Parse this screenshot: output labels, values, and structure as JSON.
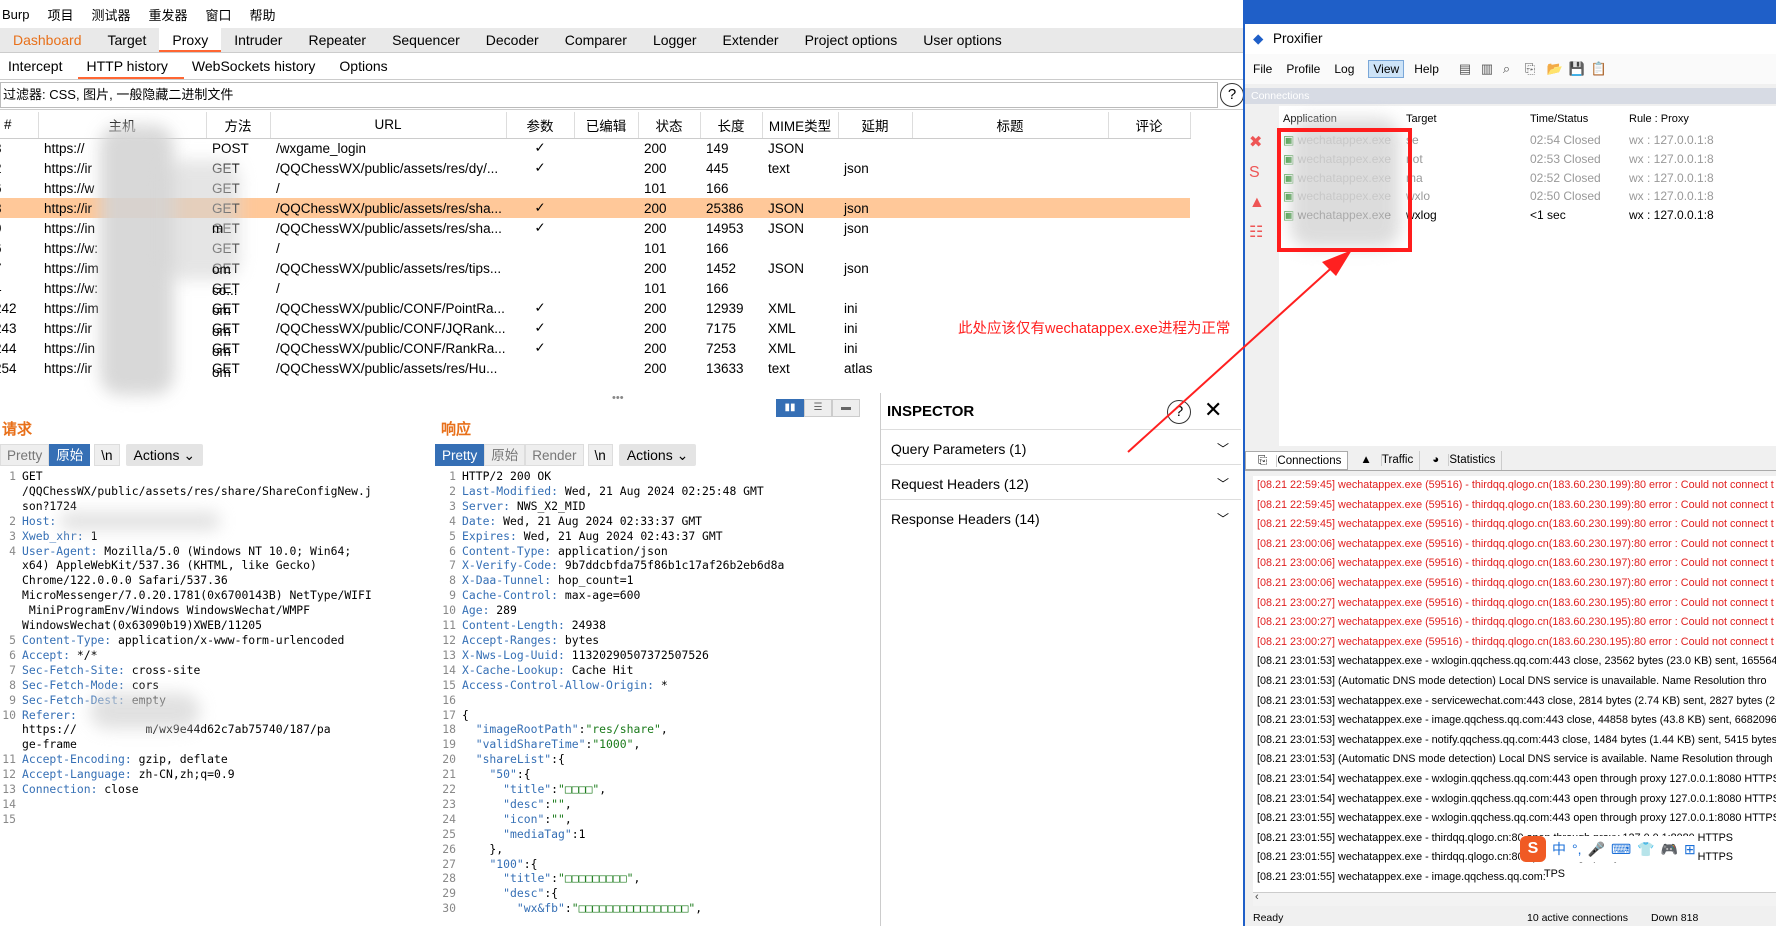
{
  "burp": {
    "menu": [
      "Burp",
      "项目",
      "测试器",
      "重发器",
      "窗口",
      "帮助"
    ],
    "tabs": [
      "Dashboard",
      "Target",
      "Proxy",
      "Intruder",
      "Repeater",
      "Sequencer",
      "Decoder",
      "Comparer",
      "Logger",
      "Extender",
      "Project options",
      "User options"
    ],
    "active_tab": "Proxy",
    "subtabs": [
      "Intercept",
      "HTTP history",
      "WebSockets history",
      "Options"
    ],
    "filter_text": "过滤器: CSS, 图片, 一般隐藏二进制文件",
    "help": "?",
    "columns": [
      "#",
      "主机",
      "方法",
      "URL",
      "参数",
      "已编辑",
      "状态",
      "长度",
      "MIME类型",
      "延期",
      "标题",
      "评论"
    ],
    "rows": [
      {
        "id": "3",
        "host": "https://",
        "method": "POST",
        "url": "/wxgame_login",
        "params": "✓",
        "status": "200",
        "length": "149",
        "mime": "JSON",
        "ext": ""
      },
      {
        "id": "2",
        "host": "https://ir",
        "method": "GET",
        "url": "/QQChessWX/public/assets/res/dy/...",
        "params": "✓",
        "status": "200",
        "length": "445",
        "mime": "text",
        "ext": "json"
      },
      {
        "id": "6",
        "host": "https://w",
        "method": "GET",
        "url": "/",
        "params": "",
        "status": "101",
        "length": "166",
        "mime": "",
        "ext": ""
      },
      {
        "id": "8",
        "host": "https://ir",
        "method": "GET",
        "url": "/QQChessWX/public/assets/res/sha...",
        "params": "✓",
        "status": "200",
        "length": "25386",
        "mime": "JSON",
        "ext": "json"
      },
      {
        "id": "9",
        "host": "https://in",
        "method": "GET",
        "url": "/QQChessWX/public/assets/res/sha...",
        "params": "✓",
        "status": "200",
        "length": "14953",
        "mime": "JSON",
        "ext": "json"
      },
      {
        "id": "6",
        "host": "https://w:",
        "method": "GET",
        "url": "/",
        "params": "",
        "status": "101",
        "length": "166",
        "mime": "",
        "ext": ""
      },
      {
        "id": "7",
        "host": "https://im",
        "method": "GET",
        "url": "/QQChessWX/public/assets/res/tips...",
        "params": "",
        "status": "200",
        "length": "1452",
        "mime": "JSON",
        "ext": "json"
      },
      {
        "id": "4",
        "host": "https://w:",
        "method": "GET",
        "url": "/",
        "params": "",
        "status": "101",
        "length": "166",
        "mime": "",
        "ext": ""
      },
      {
        "id": "242",
        "host": "https://im",
        "method": "GET",
        "url": "/QQChessWX/public/CONF/PointRa...",
        "params": "✓",
        "status": "200",
        "length": "12939",
        "mime": "XML",
        "ext": "ini"
      },
      {
        "id": "243",
        "host": "https://ir",
        "method": "GET",
        "url": "/QQChessWX/public/CONF/JQRank...",
        "params": "✓",
        "status": "200",
        "length": "7175",
        "mime": "XML",
        "ext": "ini"
      },
      {
        "id": "244",
        "host": "https://in",
        "method": "GET",
        "url": "/QQChessWX/public/CONF/RankRa...",
        "params": "✓",
        "status": "200",
        "length": "7253",
        "mime": "XML",
        "ext": "ini"
      },
      {
        "id": "254",
        "host": "https://ir",
        "method": "GET",
        "url": "/QQChessWX/public/assets/res/Hu...",
        "params": "",
        "status": "200",
        "length": "13633",
        "mime": "text",
        "ext": "atlas"
      }
    ],
    "host_suffixes": [
      "",
      "",
      "",
      "",
      "m",
      "",
      "om",
      "co...",
      "om",
      "om",
      "om",
      "om"
    ],
    "selected_row": 3,
    "request": {
      "title": "请求",
      "buttons": [
        "Pretty",
        "原始",
        "\\n"
      ],
      "active_button": "原始",
      "actions": "Actions",
      "lines": [
        {
          "n": "1",
          "k": "",
          "v": "GET"
        },
        {
          "n": "",
          "k": "",
          "v": "/QQChessWX/public/assets/res/share/ShareConfigNew.j"
        },
        {
          "n": "",
          "k": "",
          "v": "son?1724"
        },
        {
          "n": "2",
          "k": "Host:",
          "v": ""
        },
        {
          "n": "3",
          "k": "Xweb_xhr:",
          "v": "1"
        },
        {
          "n": "4",
          "k": "User-Agent:",
          "v": "Mozilla/5.0 (Windows NT 10.0; Win64;"
        },
        {
          "n": "",
          "k": "",
          "v": "x64) AppleWebKit/537.36 (KHTML, like Gecko)"
        },
        {
          "n": "",
          "k": "",
          "v": "Chrome/122.0.0.0 Safari/537.36"
        },
        {
          "n": "",
          "k": "",
          "v": "MicroMessenger/7.0.20.1781(0x6700143B) NetType/WIFI"
        },
        {
          "n": "",
          "k": "",
          "v": " MiniProgramEnv/Windows WindowsWechat/WMPF"
        },
        {
          "n": "",
          "k": "",
          "v": "WindowsWechat(0x63090b19)XWEB/11205"
        },
        {
          "n": "5",
          "k": "Content-Type:",
          "v": "application/x-www-form-urlencoded"
        },
        {
          "n": "6",
          "k": "Accept:",
          "v": "*/*"
        },
        {
          "n": "7",
          "k": "Sec-Fetch-Site:",
          "v": "cross-site"
        },
        {
          "n": "8",
          "k": "Sec-Fetch-Mode:",
          "v": "cors"
        },
        {
          "n": "9",
          "k": "Sec-Fetch-Dest:",
          "v": "empty"
        },
        {
          "n": "10",
          "k": "Referer:",
          "v": ""
        },
        {
          "n": "",
          "k": "",
          "v": "https://          m/wx9e44d62c7ab75740/187/pa"
        },
        {
          "n": "",
          "k": "",
          "v": "ge-frame"
        },
        {
          "n": "11",
          "k": "Accept-Encoding:",
          "v": "gzip, deflate"
        },
        {
          "n": "12",
          "k": "Accept-Language:",
          "v": "zh-CN,zh;q=0.9"
        },
        {
          "n": "13",
          "k": "Connection:",
          "v": "close"
        },
        {
          "n": "14",
          "k": "",
          "v": ""
        },
        {
          "n": "15",
          "k": "",
          "v": ""
        }
      ]
    },
    "response": {
      "title": "响应",
      "buttons": [
        "Pretty",
        "原始",
        "Render",
        "\\n"
      ],
      "active_button": "Pretty",
      "actions": "Actions",
      "lines": [
        {
          "n": "1",
          "k": "",
          "v": "HTTP/2 200 OK"
        },
        {
          "n": "2",
          "k": "Last-Modified:",
          "v": "Wed, 21 Aug 2024 02:25:48 GMT"
        },
        {
          "n": "3",
          "k": "Server:",
          "v": "NWS_X2_MID"
        },
        {
          "n": "4",
          "k": "Date:",
          "v": "Wed, 21 Aug 2024 02:33:37 GMT"
        },
        {
          "n": "5",
          "k": "Expires:",
          "v": "Wed, 21 Aug 2024 02:43:37 GMT"
        },
        {
          "n": "6",
          "k": "Content-Type:",
          "v": "application/json"
        },
        {
          "n": "7",
          "k": "X-Verify-Code:",
          "v": "9b7ddcbfda75f86b1c17af26b2eb6d8a"
        },
        {
          "n": "8",
          "k": "X-Daa-Tunnel:",
          "v": "hop_count=1"
        },
        {
          "n": "9",
          "k": "Cache-Control:",
          "v": "max-age=600"
        },
        {
          "n": "10",
          "k": "Age:",
          "v": "289"
        },
        {
          "n": "11",
          "k": "Content-Length:",
          "v": "24938"
        },
        {
          "n": "12",
          "k": "Accept-Ranges:",
          "v": "bytes"
        },
        {
          "n": "13",
          "k": "X-Nws-Log-Uuid:",
          "v": "11320290507372507526"
        },
        {
          "n": "14",
          "k": "X-Cache-Lookup:",
          "v": "Cache Hit"
        },
        {
          "n": "15",
          "k": "Access-Control-Allow-Origin:",
          "v": "*"
        },
        {
          "n": "16",
          "k": "",
          "v": ""
        },
        {
          "n": "17",
          "k": "",
          "v": "{"
        },
        {
          "n": "18",
          "k": "",
          "v": "  \"imageRootPath\":\"res/share\","
        },
        {
          "n": "19",
          "k": "",
          "v": "  \"validShareTime\":\"1000\","
        },
        {
          "n": "20",
          "k": "",
          "v": "  \"shareList\":{"
        },
        {
          "n": "21",
          "k": "",
          "v": "    \"50\":{"
        },
        {
          "n": "22",
          "k": "",
          "v": "      \"title\":\"□□□□\","
        },
        {
          "n": "23",
          "k": "",
          "v": "      \"desc\":\"\","
        },
        {
          "n": "24",
          "k": "",
          "v": "      \"icon\":\"\","
        },
        {
          "n": "25",
          "k": "",
          "v": "      \"mediaTag\":1"
        },
        {
          "n": "26",
          "k": "",
          "v": "    },"
        },
        {
          "n": "27",
          "k": "",
          "v": "    \"100\":{"
        },
        {
          "n": "28",
          "k": "",
          "v": "      \"title\":\"□□□□□□□□□\","
        },
        {
          "n": "29",
          "k": "",
          "v": "      \"desc\":{"
        },
        {
          "n": "30",
          "k": "",
          "v": "        \"wx&fb\":\"□□□□□□□□□□□□□□□□\","
        }
      ]
    },
    "inspector": {
      "title": "INSPECTOR",
      "sections": [
        "Query Parameters (1)",
        "Request Headers (12)",
        "Response Headers (14)"
      ]
    }
  },
  "proxifier": {
    "title": "Proxifier",
    "menu": [
      "File",
      "Profile",
      "Log",
      "View",
      "Help"
    ],
    "active_menu": "View",
    "connections_label": "Connections",
    "columns": [
      "Application",
      "Target",
      "Time/Status",
      "Rule : Proxy"
    ],
    "rows": [
      {
        "app": "wechatappex.exe",
        "target": "se",
        "time": "02:54 Closed",
        "rule": "wx : 127.0.0.1:8",
        "active": false
      },
      {
        "app": "wechatappex.exe",
        "target": "not",
        "time": "02:53 Closed",
        "rule": "wx : 127.0.0.1:8",
        "active": false
      },
      {
        "app": "wechatappex.exe",
        "target": "ma",
        "time": "02:52 Closed",
        "rule": "wx : 127.0.0.1:8",
        "active": false
      },
      {
        "app": "wechatappex.exe",
        "target": "wxlo",
        "time": "02:50 Closed",
        "rule": "wx : 127.0.0.1:8",
        "active": false
      },
      {
        "app": "wechatappex.exe",
        "target": "wxlog",
        "time": "<1 sec",
        "rule": "wx : 127.0.0.1:8",
        "active": true
      }
    ],
    "bottom_tabs": [
      "Connections",
      "Traffic",
      "Statistics"
    ],
    "log": [
      {
        "t": "[08.21 22:59:45] wechatappex.exe (59516) - thirdqq.qlogo.cn(183.60.230.199):80 error : Could not connect t",
        "err": true
      },
      {
        "t": "[08.21 22:59:45] wechatappex.exe (59516) - thirdqq.qlogo.cn(183.60.230.199):80 error : Could not connect t",
        "err": true
      },
      {
        "t": "[08.21 22:59:45] wechatappex.exe (59516) - thirdqq.qlogo.cn(183.60.230.199):80 error : Could not connect t",
        "err": true
      },
      {
        "t": "[08.21 23:00:06] wechatappex.exe (59516) - thirdqq.qlogo.cn(183.60.230.197):80 error : Could not connect t",
        "err": true
      },
      {
        "t": "[08.21 23:00:06] wechatappex.exe (59516) - thirdqq.qlogo.cn(183.60.230.197):80 error : Could not connect t",
        "err": true
      },
      {
        "t": "[08.21 23:00:06] wechatappex.exe (59516) - thirdqq.qlogo.cn(183.60.230.197):80 error : Could not connect t",
        "err": true
      },
      {
        "t": "[08.21 23:00:27] wechatappex.exe (59516) - thirdqq.qlogo.cn(183.60.230.195):80 error : Could not connect t",
        "err": true
      },
      {
        "t": "[08.21 23:00:27] wechatappex.exe (59516) - thirdqq.qlogo.cn(183.60.230.195):80 error : Could not connect t",
        "err": true
      },
      {
        "t": "[08.21 23:00:27] wechatappex.exe (59516) - thirdqq.qlogo.cn(183.60.230.195):80 error : Could not connect t",
        "err": true
      },
      {
        "t": "[08.21 23:01:53] wechatappex.exe - wxlogin.qqchess.qq.com:443 close, 23562 bytes (23.0 KB) sent, 165564",
        "err": false
      },
      {
        "t": "[08.21 23:01:53] (Automatic DNS mode detection) Local DNS service is unavailable. Name Resolution thro",
        "err": false
      },
      {
        "t": "[08.21 23:01:53] wechatappex.exe - servicewechat.com:443 close, 2814 bytes (2.74 KB) sent, 2827 bytes (2.",
        "err": false
      },
      {
        "t": "[08.21 23:01:53] wechatappex.exe - image.qqchess.qq.com:443 close, 44858 bytes (43.8 KB) sent, 66820964",
        "err": false
      },
      {
        "t": "[08.21 23:01:53] wechatappex.exe - notify.qqchess.qq.com:443 close, 1484 bytes (1.44 KB) sent, 5415 bytes",
        "err": false
      },
      {
        "t": "[08.21 23:01:53] (Automatic DNS mode detection) Local DNS service is available. Name Resolution through",
        "err": false
      },
      {
        "t": "[08.21 23:01:54] wechatappex.exe - wxlogin.qqchess.qq.com:443 open through proxy 127.0.0.1:8080 HTTPS",
        "err": false
      },
      {
        "t": "[08.21 23:01:54] wechatappex.exe - wxlogin.qqchess.qq.com:443 open through proxy 127.0.0.1:8080 HTTPS",
        "err": false
      },
      {
        "t": "[08.21 23:01:55] wechatappex.exe - wxlogin.qqchess.qq.com:443 open through proxy 127.0.0.1:8080 HTTPS",
        "err": false
      },
      {
        "t": "[08.21 23:01:55] wechatappex.exe - thirdqq.qlogo.cn:80 open through proxy 127.0.0.1:8080 HTTPS",
        "err": false
      },
      {
        "t": "[08.21 23:01:55] wechatappex.exe - thirdqq.qlogo.cn:80 open through proxy 127.0.0.1:8080 HTTPS",
        "err": false
      },
      {
        "t": "[08.21 23:01:55] wechatappex.exe - image.qqchess.qq.com:",
        "err": false
      }
    ],
    "log_tail": "TPS",
    "status_left": "Ready",
    "status_mid": "10 active connections",
    "status_right": "Down 818"
  },
  "annotation": "此处应该仅有wechatappex.exe进程为正常",
  "ime": [
    "S",
    "中",
    "°,",
    "🎤",
    "⌨",
    "👕",
    "🎮",
    "⊞"
  ]
}
